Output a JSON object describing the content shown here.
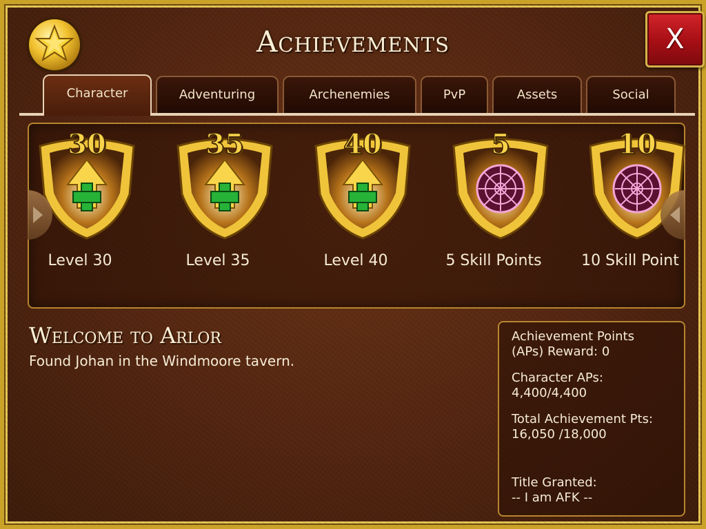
{
  "window": {
    "title": "Achievements",
    "close_label": "X"
  },
  "tabs": [
    {
      "label": "Character",
      "active": true
    },
    {
      "label": "Adventuring",
      "active": false
    },
    {
      "label": "Archenemies",
      "active": false
    },
    {
      "label": "PvP",
      "active": false
    },
    {
      "label": "Assets",
      "active": false
    },
    {
      "label": "Social",
      "active": false
    }
  ],
  "achievements": [
    {
      "number": "30",
      "label": "Level 30",
      "icon": "level-up-arrow-icon"
    },
    {
      "number": "35",
      "label": "Level 35",
      "icon": "level-up-arrow-icon"
    },
    {
      "number": "40",
      "label": "Level 40",
      "icon": "level-up-arrow-icon"
    },
    {
      "number": "5",
      "label": "5 Skill Points",
      "icon": "skill-sigil-icon"
    },
    {
      "number": "10",
      "label": "10 Skill Point",
      "icon": "skill-sigil-icon"
    }
  ],
  "selected": {
    "title": "Welcome to Arlor",
    "description": "Found Johan in the Windmoore tavern."
  },
  "info": {
    "reward_label": "Achievement Points",
    "reward_value": "(APs) Reward: 0",
    "character_label": "Character APs:",
    "character_value": "4,400/4,400",
    "total_label": "Total Achievement Pts:",
    "total_value": "16,050 /18,000",
    "title_label": "Title Granted:",
    "title_value": "-- I am AFK --"
  },
  "colors": {
    "gold": "#c9a227",
    "panel_bg": "#4f2410",
    "close_red": "#a50f15",
    "text": "#f6ecd6"
  }
}
